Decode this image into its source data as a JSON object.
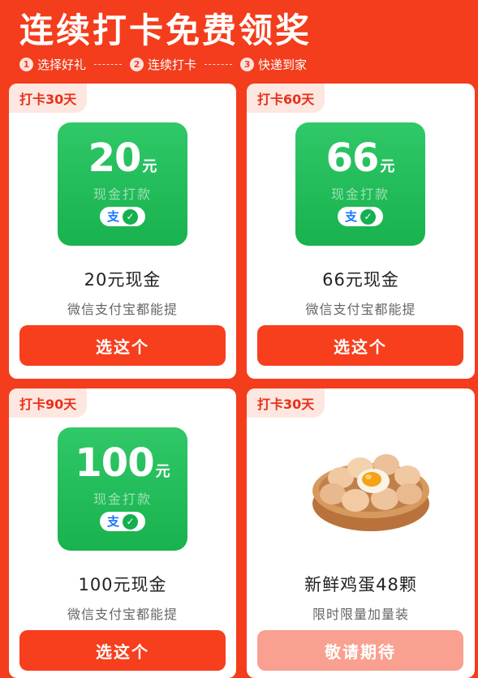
{
  "header": {
    "title": "连续打卡免费领奖",
    "steps": [
      {
        "num": "1",
        "label": "选择好礼"
      },
      {
        "num": "2",
        "label": "连续打卡"
      },
      {
        "num": "3",
        "label": "快递到家"
      }
    ]
  },
  "cards": [
    {
      "badge": "打卡30天",
      "amount": "20",
      "unit": "元",
      "sub": "现金打款",
      "name": "20元现金",
      "desc": "微信支付宝都能提",
      "button": "选这个"
    },
    {
      "badge": "打卡60天",
      "amount": "66",
      "unit": "元",
      "sub": "现金打款",
      "name": "66元现金",
      "desc": "微信支付宝都能提",
      "button": "选这个"
    },
    {
      "badge": "打卡90天",
      "amount": "100",
      "unit": "元",
      "sub": "现金打款",
      "name": "100元现金",
      "desc": "微信支付宝都能提",
      "button": "选这个"
    },
    {
      "badge": "打卡30天",
      "name": "新鲜鸡蛋48颗",
      "desc": "限时限量加量装",
      "button": "敬请期待"
    }
  ],
  "icons": {
    "alipay": "支",
    "wechat": "✓"
  },
  "colors": {
    "background": "#f33d1c",
    "button": "#f73e1d",
    "button_disabled": "#f9a090",
    "cash_tile": "#1fb855",
    "badge_bg": "#fde7e0"
  }
}
